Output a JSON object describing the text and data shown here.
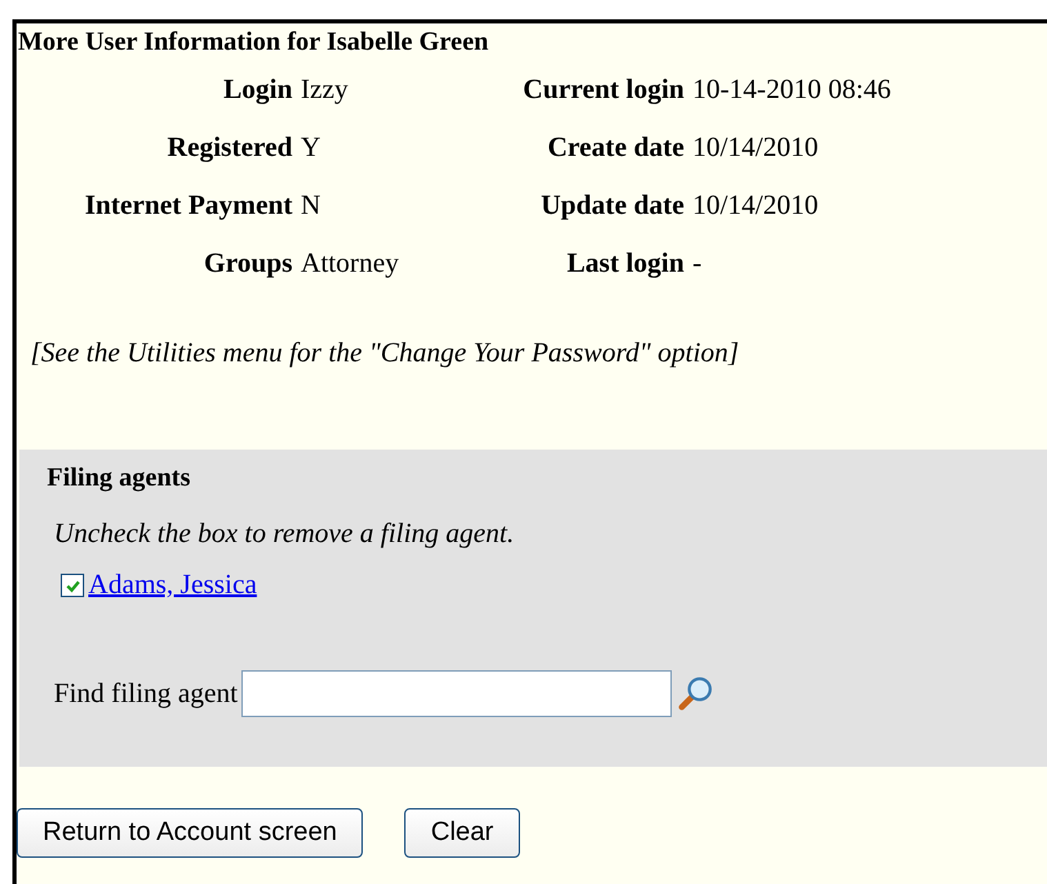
{
  "title": "More User Information for Isabelle Green",
  "info_rows": [
    {
      "label": "Login",
      "value": "Izzy",
      "label_2": "Current login",
      "value_2": "10-14-2010 08:46"
    },
    {
      "label": "Registered",
      "value": "Y",
      "label_2": "Create date",
      "value_2": "10/14/2010"
    },
    {
      "label": "Internet Payment",
      "value": "N",
      "label_2": "Update date",
      "value_2": "10/14/2010"
    },
    {
      "label": "Groups",
      "value": "Attorney",
      "label_2": "Last login",
      "value_2": "-"
    }
  ],
  "note": "[See the Utilities menu for the \"Change Your Password\" option]",
  "filing_agents": {
    "heading": "Filing agents",
    "instruction": "Uncheck the box to remove a filing agent.",
    "agents": [
      {
        "name": "Adams, Jessica",
        "checked": true
      }
    ],
    "find_label": "Find filing agent"
  },
  "buttons": [
    "Return to Account screen",
    "Clear"
  ]
}
